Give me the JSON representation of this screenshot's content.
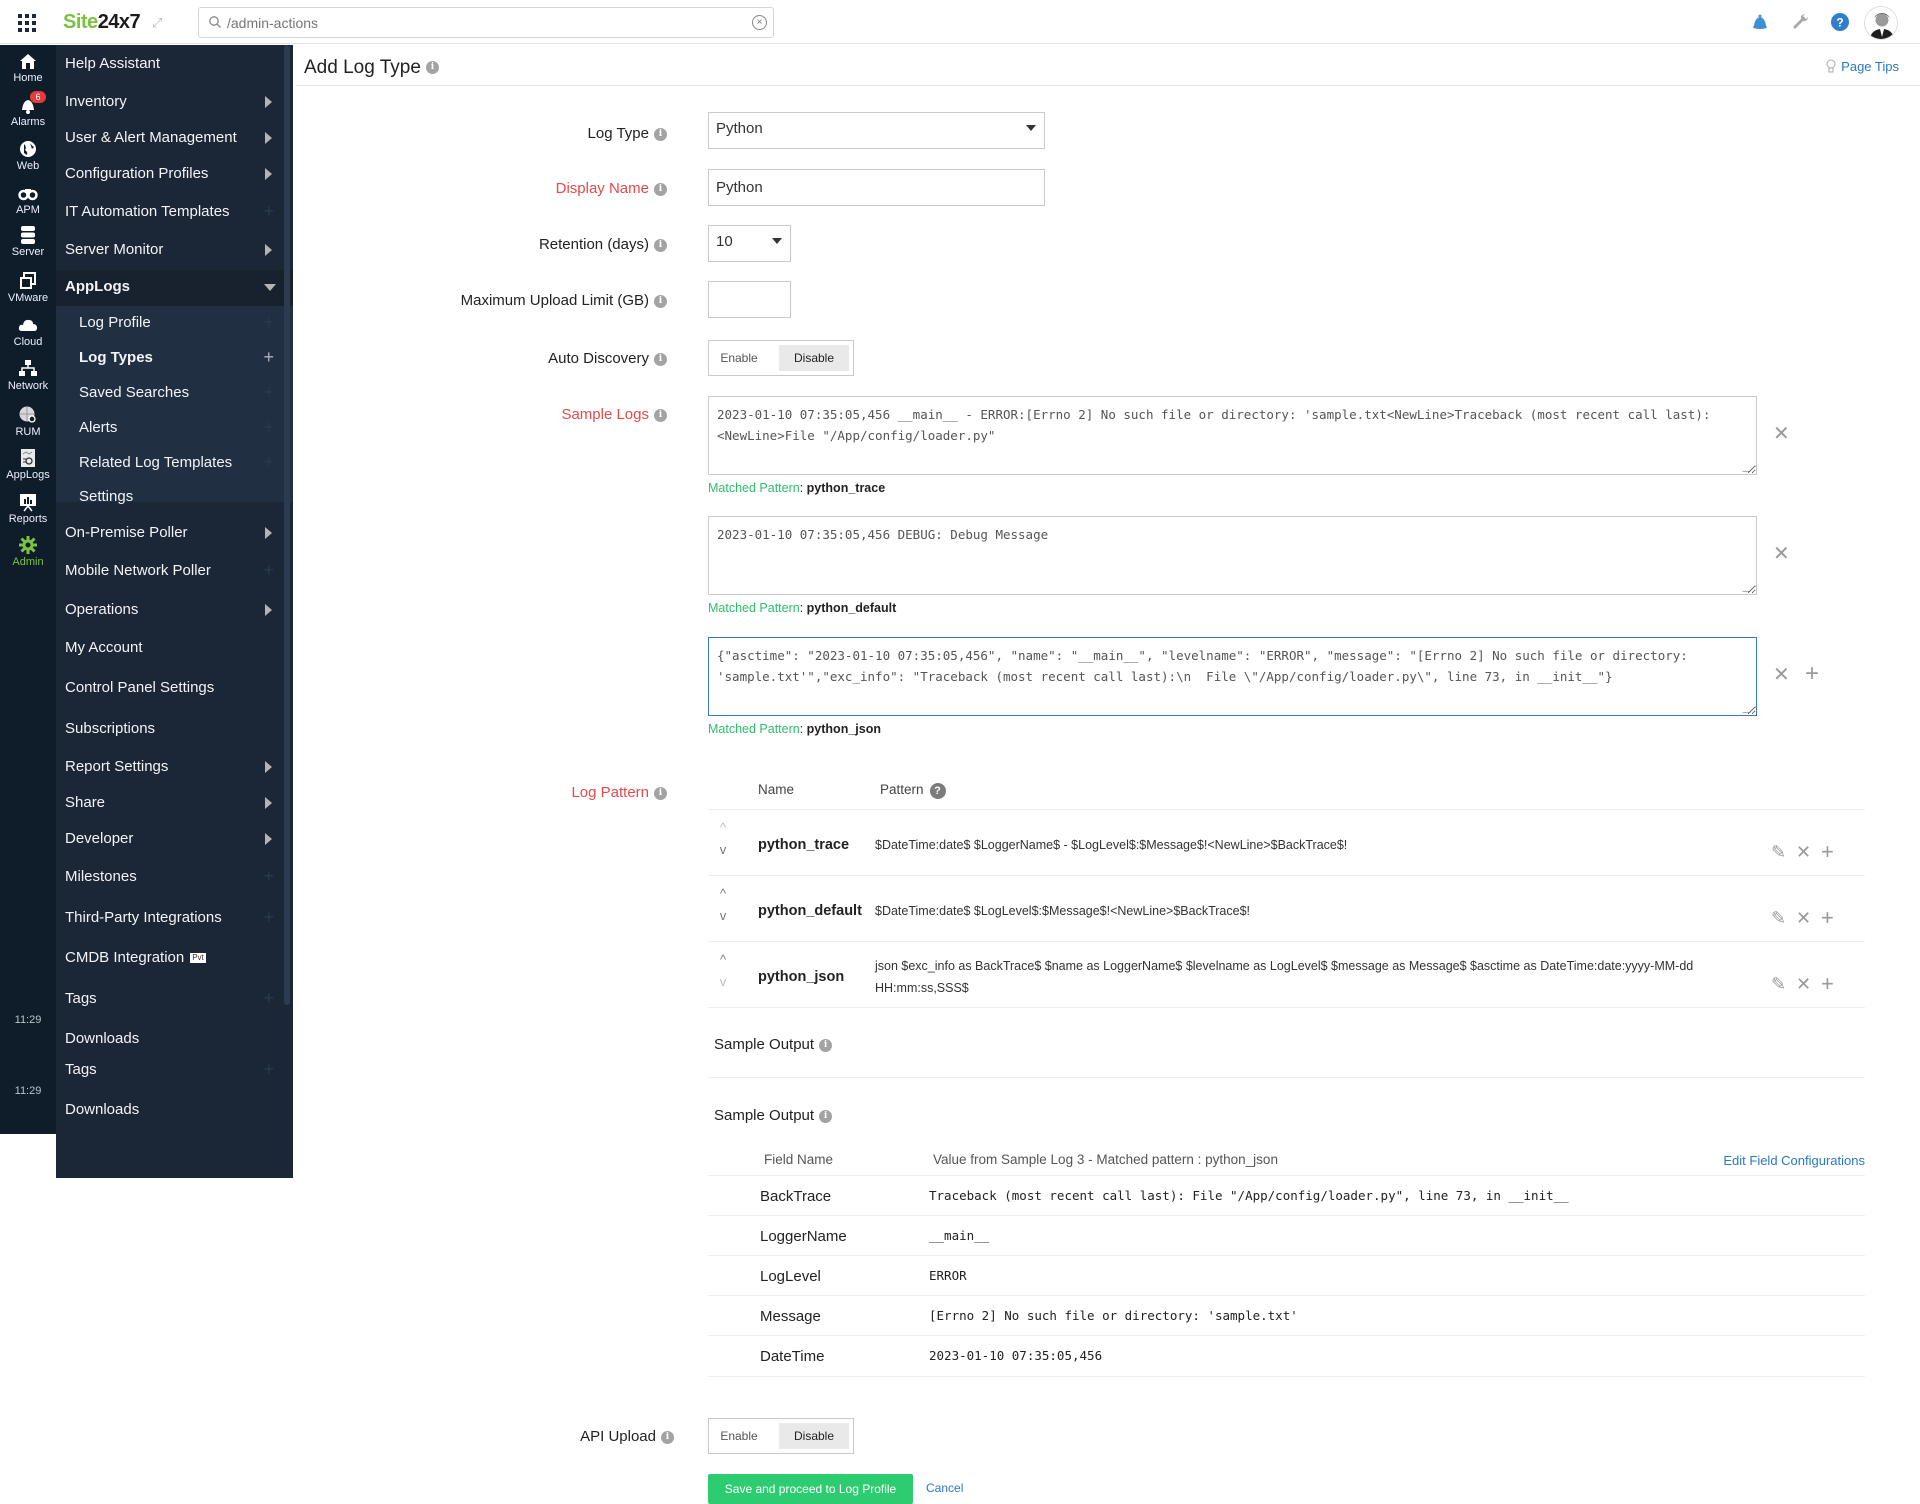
{
  "header": {
    "logo_part1": "Site",
    "logo_part2": "24x7",
    "search_placeholder": "/admin-actions",
    "search_value": ""
  },
  "rail": {
    "items": [
      {
        "label": "Home",
        "icon": "home-icon"
      },
      {
        "label": "Alarms",
        "icon": "bell-icon",
        "badge": "6"
      },
      {
        "label": "Web",
        "icon": "globe-icon"
      },
      {
        "label": "APM",
        "icon": "binoculars-icon"
      },
      {
        "label": "Server",
        "icon": "server-icon"
      },
      {
        "label": "VMware",
        "icon": "vmware-icon"
      },
      {
        "label": "Cloud",
        "icon": "cloud-icon"
      },
      {
        "label": "Network",
        "icon": "network-icon"
      },
      {
        "label": "RUM",
        "icon": "rum-icon"
      },
      {
        "label": "AppLogs",
        "icon": "applogs-icon"
      },
      {
        "label": "Reports",
        "icon": "reports-icon"
      },
      {
        "label": "Admin",
        "icon": "gear-icon",
        "active": true
      }
    ],
    "times": [
      "11:29",
      "11:29"
    ]
  },
  "menu": {
    "items": [
      {
        "label": "Help Assistant"
      },
      {
        "label": "Inventory"
      },
      {
        "label": "User & Alert Management"
      },
      {
        "label": "Configuration Profiles"
      },
      {
        "label": "IT Automation Templates"
      },
      {
        "label": "Server Monitor"
      },
      {
        "label": "AppLogs"
      },
      {
        "label": "Log Profile"
      },
      {
        "label": "Log Types"
      },
      {
        "label": "Saved Searches"
      },
      {
        "label": "Alerts"
      },
      {
        "label": "Related Log Templates"
      },
      {
        "label": "Settings"
      },
      {
        "label": "On-Premise Poller"
      },
      {
        "label": "Mobile Network Poller"
      },
      {
        "label": "Operations"
      },
      {
        "label": "My Account"
      },
      {
        "label": "Control Panel Settings"
      },
      {
        "label": "Subscriptions"
      },
      {
        "label": "Report Settings"
      },
      {
        "label": "Share"
      },
      {
        "label": "Developer"
      },
      {
        "label": "Milestones"
      },
      {
        "label": "Third-Party Integrations"
      },
      {
        "label": "CMDB Integration",
        "badge": "Pvt"
      },
      {
        "label": "Tags"
      },
      {
        "label": "Downloads"
      },
      {
        "label": "Tags"
      },
      {
        "label": "Downloads"
      }
    ]
  },
  "page": {
    "title": "Add Log Type",
    "page_tips": "Page Tips"
  },
  "form": {
    "log_type": {
      "label": "Log Type",
      "value": "Python"
    },
    "display_name": {
      "label": "Display Name",
      "value": "Python"
    },
    "retention": {
      "label": "Retention (days)",
      "value": "10"
    },
    "max_upload": {
      "label": "Maximum Upload Limit (GB)",
      "value": ""
    },
    "auto_discovery": {
      "label": "Auto Discovery",
      "enable": "Enable",
      "disable": "Disable",
      "selected": "Disable"
    },
    "sample_logs": {
      "label": "Sample Logs",
      "matched_label": "Matched Pattern",
      "items": [
        {
          "text": "2023-01-10 07:35:05,456 __main__ - ERROR:[Errno 2] No such file or directory: 'sample.txt<NewLine>Traceback (most recent call last):<NewLine>File \"/App/config/loader.py\"",
          "matched": "python_trace"
        },
        {
          "text": "2023-01-10 07:35:05,456 DEBUG: Debug Message",
          "matched": "python_default"
        },
        {
          "text": "{\"asctime\": \"2023-01-10 07:35:05,456\", \"name\": \"__main__\", \"levelname\": \"ERROR\", \"message\": \"[Errno 2] No such file or directory: 'sample.txt'\",\"exc_info\": \"Traceback (most recent call last):\\n  File \\\"/App/config/loader.py\\\", line 73, in __init__\"}",
          "matched": "python_json"
        }
      ]
    },
    "log_pattern": {
      "label": "Log Pattern",
      "col_name": "Name",
      "col_pattern": "Pattern",
      "rows": [
        {
          "name": "python_trace",
          "pattern": "$DateTime:date$ $LoggerName$ - $LogLevel$:$Message$!<NewLine>$BackTrace$!"
        },
        {
          "name": "python_default",
          "pattern": "$DateTime:date$ $LogLevel$:$Message$!<NewLine>$BackTrace$!"
        },
        {
          "name": "python_json",
          "pattern": "json $exc_info as BackTrace$ $name as LoggerName$ $levelname as LogLevel$ $message as Message$ $asctime as DateTime:date:yyyy-MM-dd HH:mm:ss,SSS$"
        }
      ]
    },
    "sample_output_1": {
      "label": "Sample Output"
    },
    "sample_output_2": {
      "label": "Sample Output",
      "col_field": "Field Name",
      "col_value": "Value from Sample Log 3 - Matched pattern : python_json",
      "edit_link": "Edit Field Configurations",
      "rows": [
        {
          "field": "BackTrace",
          "value": "Traceback (most recent call last): File \"/App/config/loader.py\", line 73, in __init__"
        },
        {
          "field": "LoggerName",
          "value": "__main__"
        },
        {
          "field": "LogLevel",
          "value": "ERROR"
        },
        {
          "field": "Message",
          "value": "[Errno 2] No such file or directory: 'sample.txt'"
        },
        {
          "field": "DateTime",
          "value": "2023-01-10 07:35:05,456"
        }
      ]
    },
    "api_upload": {
      "label": "API Upload",
      "enable": "Enable",
      "disable": "Disable",
      "selected": "Disable"
    },
    "save_button": "Save and proceed to Log Profile",
    "cancel_link": "Cancel"
  },
  "colors": {
    "brand_green": "#7cc142",
    "required_red": "#e34a4a",
    "matched_green": "#2ebd6a",
    "link_blue": "#2a78c2",
    "save_green": "#2ecc71",
    "sidebar_bg": "#1b2636",
    "rail_bg": "#0e1d29"
  }
}
